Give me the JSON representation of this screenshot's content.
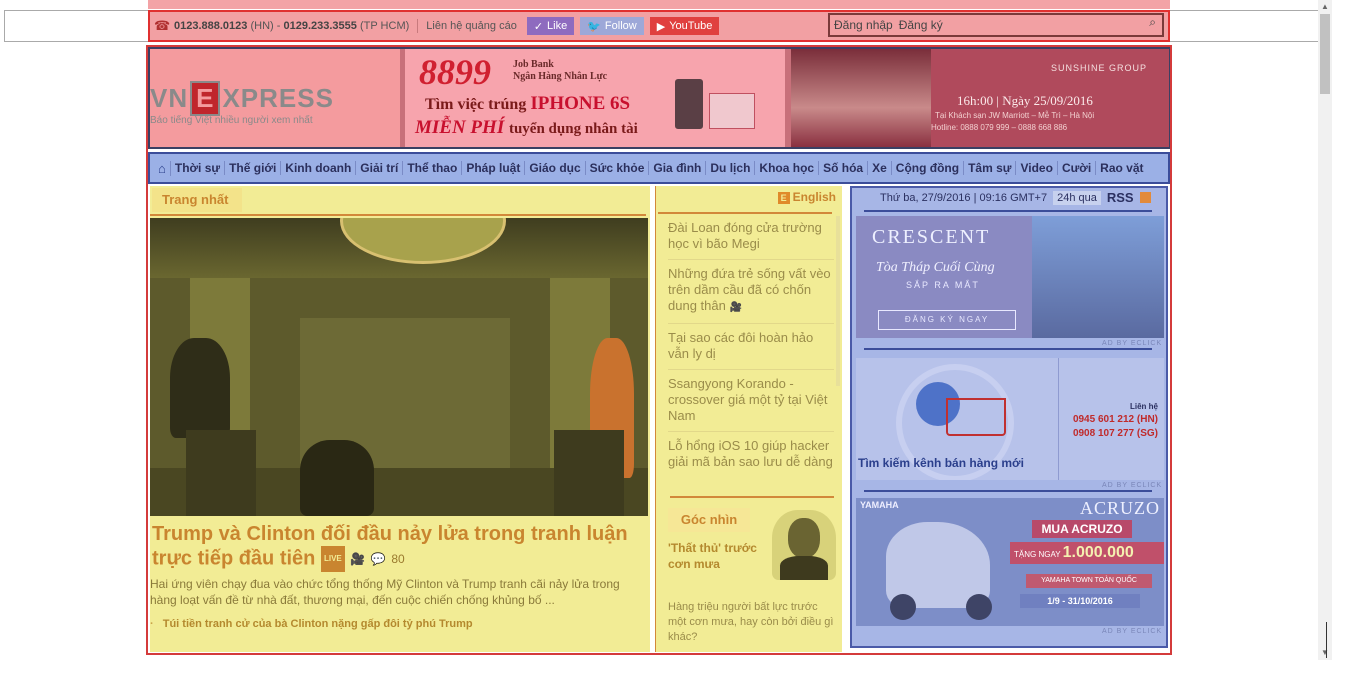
{
  "topbar": {
    "hotline_hn": "0123.888.0123",
    "hotline_hn_tag": "(HN)",
    "hotline_sep": "-",
    "hotline_hcm": "0129.233.3555",
    "hotline_hcm_tag": "(TP HCM)",
    "ads_contact": "Liên hệ quảng cáo",
    "like_label": "Like",
    "follow_label": "Follow",
    "youtube_label": "YouTube",
    "login_label": "Đăng nhập",
    "register_label": "Đăng ký",
    "search_placeholder": ""
  },
  "brand": {
    "logo_left": "VN",
    "logo_box": "E",
    "logo_right": "XPRESS",
    "tagline": "Báo tiếng Việt nhiều người xem nhất"
  },
  "banner_jobbank": {
    "number": "8899",
    "sub1": "Job Bank",
    "sub2": "Ngân Hàng Nhân Lực",
    "line1_prefix": "Tìm việc trúng",
    "line1_highlight": "IPHONE 6S",
    "line2_highlight": "MIỄN PHÍ",
    "line2_suffix": "tuyển dụng nhân tài"
  },
  "banner_sunshine": {
    "brand": "SUNSHINE GROUP",
    "line1": "16h:00 | Ngày 25/09/2016",
    "line2": "Tại Khách sạn JW Marriott – Mễ Trì – Hà Nội",
    "line3": "Hotline: 0888 079 999 – 0888 668 886"
  },
  "nav": {
    "items": [
      "Thời sự",
      "Thế giới",
      "Kinh doanh",
      "Giải trí",
      "Thể thao",
      "Pháp luật",
      "Giáo dục",
      "Sức khỏe",
      "Gia đình",
      "Du lịch",
      "Khoa học",
      "Số hóa",
      "Xe",
      "Cộng đồng",
      "Tâm sự",
      "Video",
      "Cười",
      "Rao vặt"
    ]
  },
  "feature": {
    "section_label": "Trang nhất",
    "headline": "Trump và Clinton đối đầu nảy lửa trong tranh luận trực tiếp đầu tiên",
    "live_badge": "LIVE",
    "comment_count": "80",
    "description": "Hai ứng viên chạy đua vào chức tổng thống Mỹ Clinton và Trump tranh cãi nảy lửa trong hàng loạt vấn đề từ nhà đất, thương mại, đến cuộc chiến chống khủng bố ...",
    "related": "Túi tiền tranh cử của bà Clinton nặng gấp đôi tỷ phú Trump"
  },
  "sidelist": {
    "english_label": "English",
    "items": [
      "Đài Loan đóng cửa trường học vì bão Megi",
      "Những đứa trẻ sống vất vèo trên dầm cầu đã có chốn dung thân",
      "Tại sao các đôi hoàn hảo vẫn ly dị",
      "Ssangyong Korando - crossover giá một tỷ tại Việt Nam",
      "Lỗ hổng iOS 10 giúp hacker giải mã bản sao lưu dễ dàng"
    ]
  },
  "gocnhin": {
    "label": "Góc nhìn",
    "title": "'Thất thủ' trước cơn mưa",
    "desc": "Hàng triệu người bất lực trước một cơn mưa, hay còn bởi điều gì khác?"
  },
  "sidebar": {
    "date": "Thứ ba, 27/9/2016 | 09:16 GMT+7",
    "h24": "24h qua",
    "rss": "RSS",
    "ad_label": "AD BY ECLICK",
    "crescent": {
      "brand": "CRESCENT",
      "tagline": "Tòa Tháp Cuối Cùng",
      "sub": "SẮP RA MẮT",
      "cta": "ĐĂNG KÝ NGAY"
    },
    "cart_ad": {
      "caption": "Tìm kiếm kênh bán hàng mới",
      "contact": "Liên hệ",
      "phone_hn": "0945 601 212 (HN)",
      "phone_sg": "0908 107 277 (SG)"
    },
    "yamaha": {
      "logo": "YAMAHA",
      "model": "ACRUZO",
      "promo": "MUA ACRUZO",
      "gift_prefix": "TẶNG NGAY",
      "gift_value": "1.000.000",
      "town": "YAMAHA TOWN TOÀN QUỐC",
      "dates": "1/9 - 31/10/2016"
    }
  },
  "colors": {
    "top_overlay": "#f2a0a3",
    "nav_overlay": "#9bb0e6",
    "feature_overlay": "#f2ec95",
    "sidebar_overlay": "#a7b6e6",
    "accent_orange": "#c9852f"
  }
}
